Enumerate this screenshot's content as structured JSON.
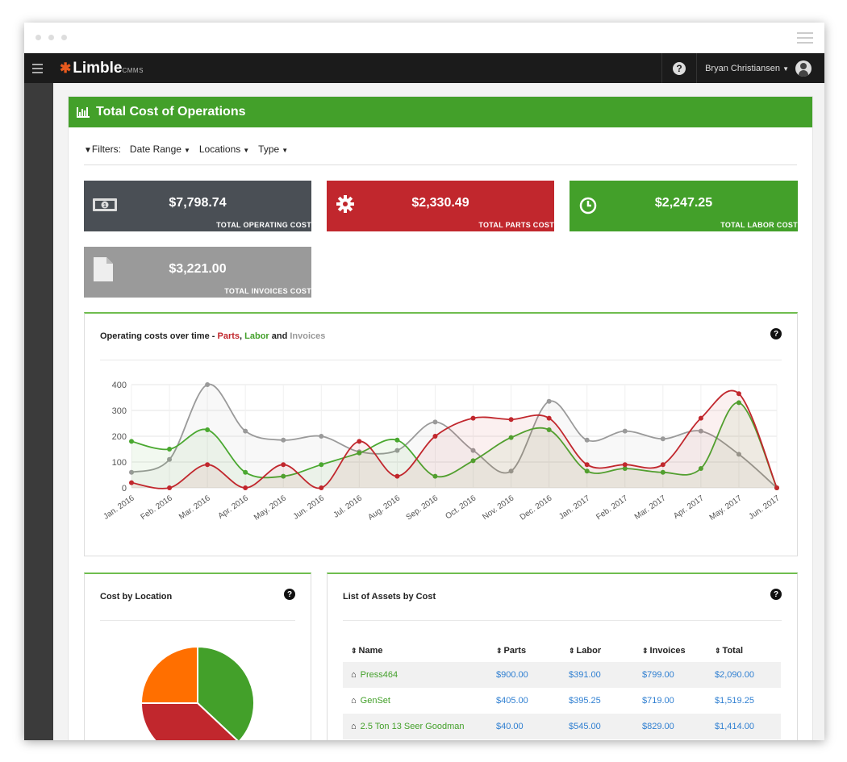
{
  "app": {
    "brand": "Limble",
    "brand_suffix": "CMMS",
    "user": "Bryan Christiansen"
  },
  "panel": {
    "title": "Total Cost of Operations"
  },
  "filters": {
    "label": "Filters:",
    "items": [
      "Date Range",
      "Locations",
      "Type"
    ]
  },
  "stats": [
    {
      "value": "$7,798.74",
      "label": "TOTAL OPERATING COST",
      "color": "#4a4f55",
      "icon": "money-icon"
    },
    {
      "value": "$2,330.49",
      "label": "TOTAL PARTS COST",
      "color": "#c1272d",
      "icon": "gear-icon"
    },
    {
      "value": "$2,247.25",
      "label": "TOTAL LABOR COST",
      "color": "#43a02a",
      "icon": "clock-icon"
    },
    {
      "value": "$3,221.00",
      "label": "TOTAL INVOICES COST",
      "color": "#9a9a9a",
      "icon": "document-icon"
    }
  ],
  "line_card": {
    "title_prefix": "Operating costs over time - ",
    "parts": "Parts",
    "sep": ", ",
    "labor": "Labor",
    "and": " and ",
    "invoices": "Invoices"
  },
  "location_card": {
    "title": "Cost by Location"
  },
  "assets_card": {
    "title": "List of Assets by Cost",
    "columns": [
      "Name",
      "Parts",
      "Labor",
      "Invoices",
      "Total"
    ],
    "rows": [
      {
        "name": "Press464",
        "parts": "$900.00",
        "labor": "$391.00",
        "invoices": "$799.00",
        "total": "$2,090.00"
      },
      {
        "name": "GenSet",
        "parts": "$405.00",
        "labor": "$395.25",
        "invoices": "$719.00",
        "total": "$1,519.25"
      },
      {
        "name": "2.5 Ton 13 Seer Goodman",
        "parts": "$40.00",
        "labor": "$545.00",
        "invoices": "$829.00",
        "total": "$1,414.00"
      }
    ]
  },
  "chart_data": [
    {
      "type": "line",
      "title": "Operating costs over time - Parts, Labor and Invoices",
      "x": [
        "Jan. 2016",
        "Feb. 2016",
        "Mar. 2016",
        "Apr. 2016",
        "May. 2016",
        "Jun. 2016",
        "Jul. 2016",
        "Aug. 2016",
        "Sep. 2016",
        "Oct. 2016",
        "Nov. 2016",
        "Dec. 2016",
        "Jan. 2017",
        "Feb. 2017",
        "Mar. 2017",
        "Apr. 2017",
        "May. 2017",
        "Jun. 2017"
      ],
      "ylim": [
        0,
        400
      ],
      "yticks": [
        0,
        100,
        200,
        300,
        400
      ],
      "grid": true,
      "series": [
        {
          "name": "Invoices",
          "color": "#9a9a9a",
          "values": [
            60,
            110,
            400,
            220,
            185,
            200,
            140,
            145,
            255,
            145,
            65,
            335,
            185,
            220,
            190,
            220,
            130,
            0
          ]
        },
        {
          "name": "Labor",
          "color": "#4aa830",
          "values": [
            180,
            150,
            225,
            60,
            45,
            90,
            135,
            185,
            45,
            105,
            195,
            225,
            65,
            75,
            60,
            75,
            330,
            0
          ]
        },
        {
          "name": "Parts",
          "color": "#c1272d",
          "values": [
            20,
            0,
            90,
            0,
            90,
            0,
            180,
            45,
            200,
            270,
            265,
            270,
            90,
            90,
            90,
            270,
            365,
            0
          ]
        }
      ]
    },
    {
      "type": "pie",
      "title": "Cost by Location",
      "slices": [
        {
          "color": "#43a02a",
          "value": 37
        },
        {
          "color": "#c1272d",
          "value": 38
        },
        {
          "color": "#ff6f00",
          "value": 25
        }
      ]
    }
  ]
}
